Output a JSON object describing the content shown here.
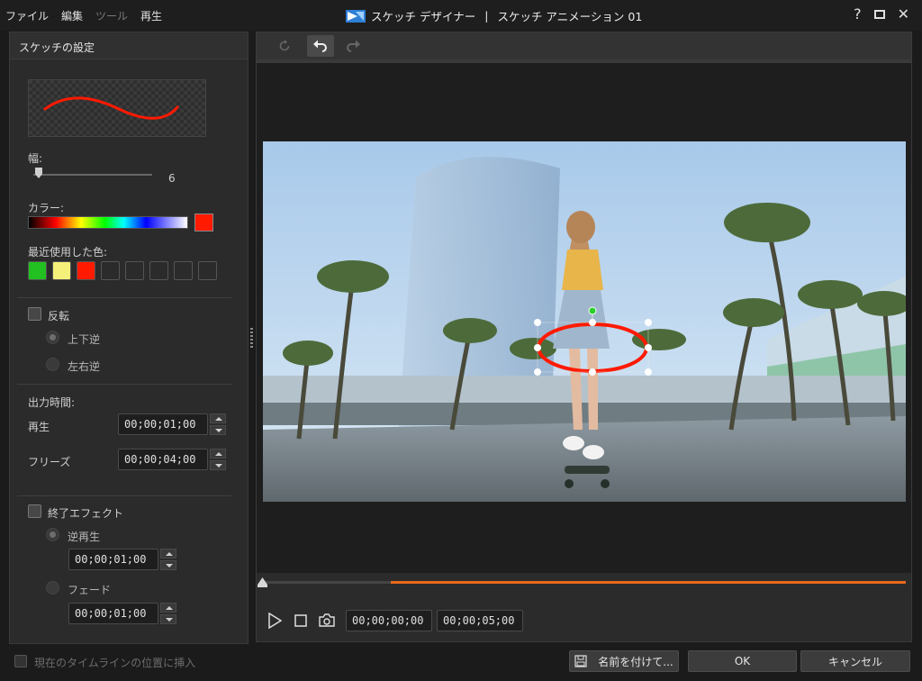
{
  "menu": {
    "file": "ファイル",
    "edit": "編集",
    "tools": "ツール",
    "play": "再生"
  },
  "title": {
    "app": "スケッチ デザイナー",
    "separator": "|",
    "document": "スケッチ アニメーション 01"
  },
  "window": {
    "help": "?",
    "close": "✕"
  },
  "panel": {
    "header": "スケッチの設定",
    "width_label": "幅:",
    "width_value": "6",
    "color_label": "カラー:",
    "selected_color": "#ff1a00",
    "recent_label": "最近使用した色:",
    "recent_colors": [
      "#22c020",
      "#f5f07a",
      "#ff1a00",
      "#2b2b2b",
      "#2b2b2b",
      "#2b2b2b",
      "#2b2b2b",
      "#2b2b2b"
    ],
    "flip_label": "反転",
    "flip_vertical": "上下逆",
    "flip_horizontal": "左右逆",
    "output_time_label": "出力時間:",
    "play_label": "再生",
    "play_time": "00;00;01;00",
    "freeze_label": "フリーズ",
    "freeze_time": "00;00;04;00",
    "end_effect_label": "終了エフェクト",
    "reverse_label": "逆再生",
    "reverse_time": "00;00;01;00",
    "fade_label": "フェード",
    "fade_time": "00;00;01;00"
  },
  "player": {
    "current_time": "00;00;00;00",
    "total_time": "00;00;05;00",
    "progress": 0.0,
    "sketch_range_start": 0.2
  },
  "bottom": {
    "insert_label": "現在のタイムラインの位置に挿入",
    "save_as": "名前を付けて...",
    "ok": "OK",
    "cancel": "キャンセル"
  },
  "colors": {
    "accent_orange": "#e8681a",
    "sketch_red": "#ff1a00",
    "rotate_handle": "#2ad02a"
  }
}
